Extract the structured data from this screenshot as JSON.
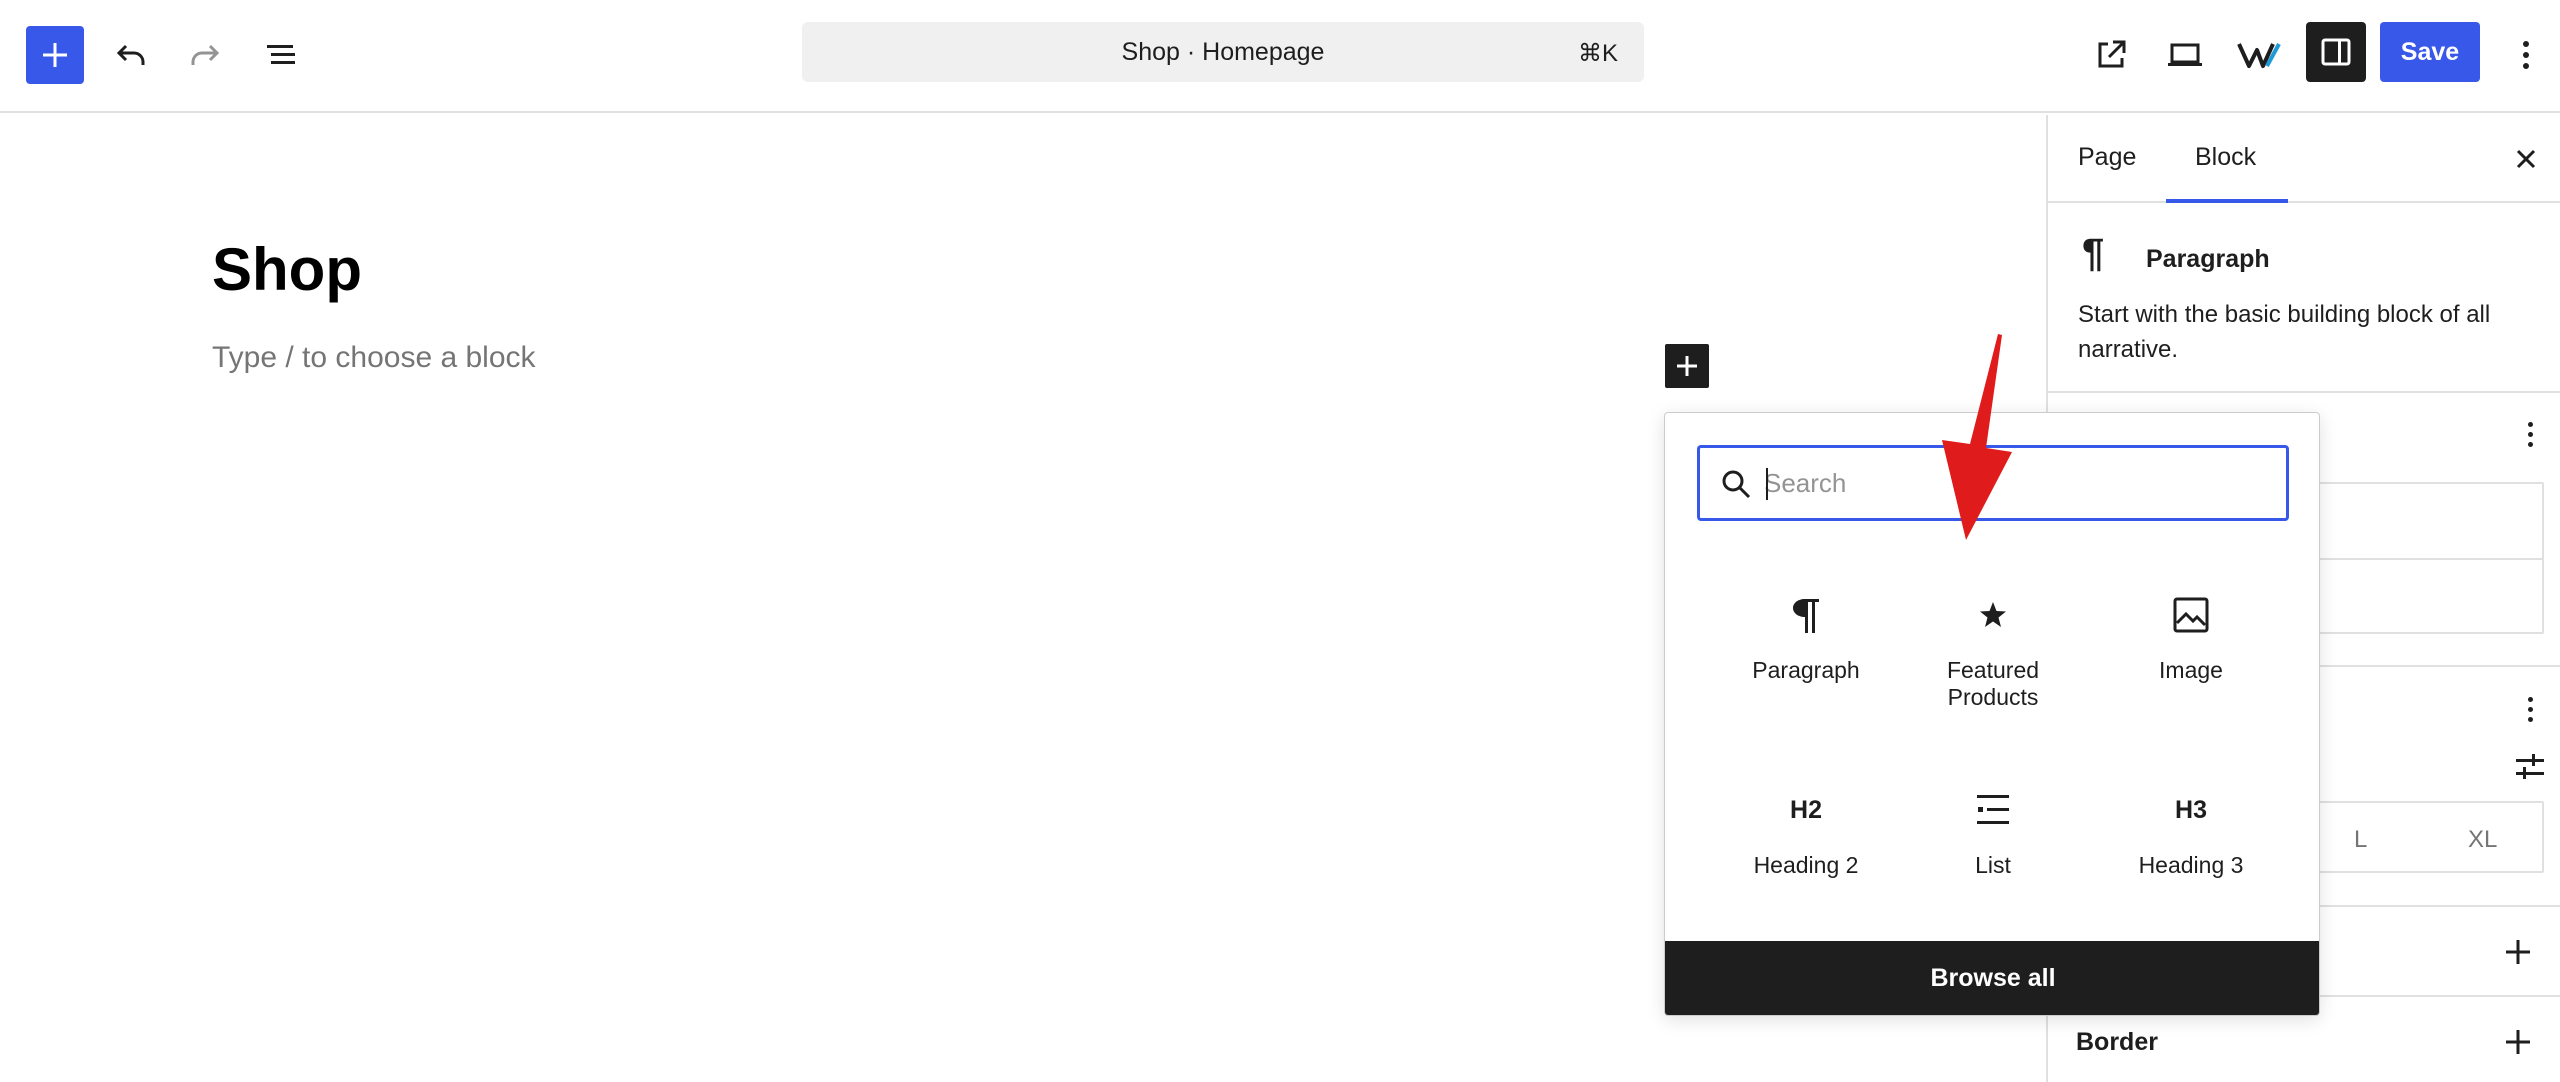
{
  "topbar": {
    "add_block_icon": "plus-icon",
    "undo_icon": "undo-icon",
    "redo_icon": "redo-icon",
    "list_view_icon": "list-view-icon",
    "command_title": "Shop · Homepage",
    "command_shortcut": "⌘K",
    "view_icon": "external-link-icon",
    "device_preview_icon": "laptop-icon",
    "plugin_icon": "plugin-logo-icon",
    "settings_icon": "sidebar-toggle-icon",
    "save_label": "Save",
    "options_icon": "more-vertical-icon"
  },
  "canvas": {
    "page_title": "Shop",
    "placeholder": "Type / to choose a block"
  },
  "inserter": {
    "search_placeholder": "Search",
    "blocks": [
      {
        "label": "Paragraph",
        "icon": "paragraph-icon"
      },
      {
        "label": "Featured Products",
        "icon": "star-icon"
      },
      {
        "label": "Image",
        "icon": "image-icon"
      },
      {
        "label": "Heading 2",
        "icon": "H2"
      },
      {
        "label": "List",
        "icon": "list-icon"
      },
      {
        "label": "Heading 3",
        "icon": "H3"
      }
    ],
    "browse_all": "Browse all"
  },
  "sidebar": {
    "tabs": [
      {
        "label": "Page"
      },
      {
        "label": "Block"
      }
    ],
    "active_tab": "Block",
    "block_card": {
      "icon": "¶",
      "name": "Paragraph",
      "description": "Start with the basic building block of all narrative."
    },
    "size_options": [
      "L",
      "XL"
    ],
    "border_label": "Border"
  },
  "colors": {
    "accent": "#3858e9",
    "dark": "#1e1e1e",
    "annotation": "#e01b1b"
  }
}
